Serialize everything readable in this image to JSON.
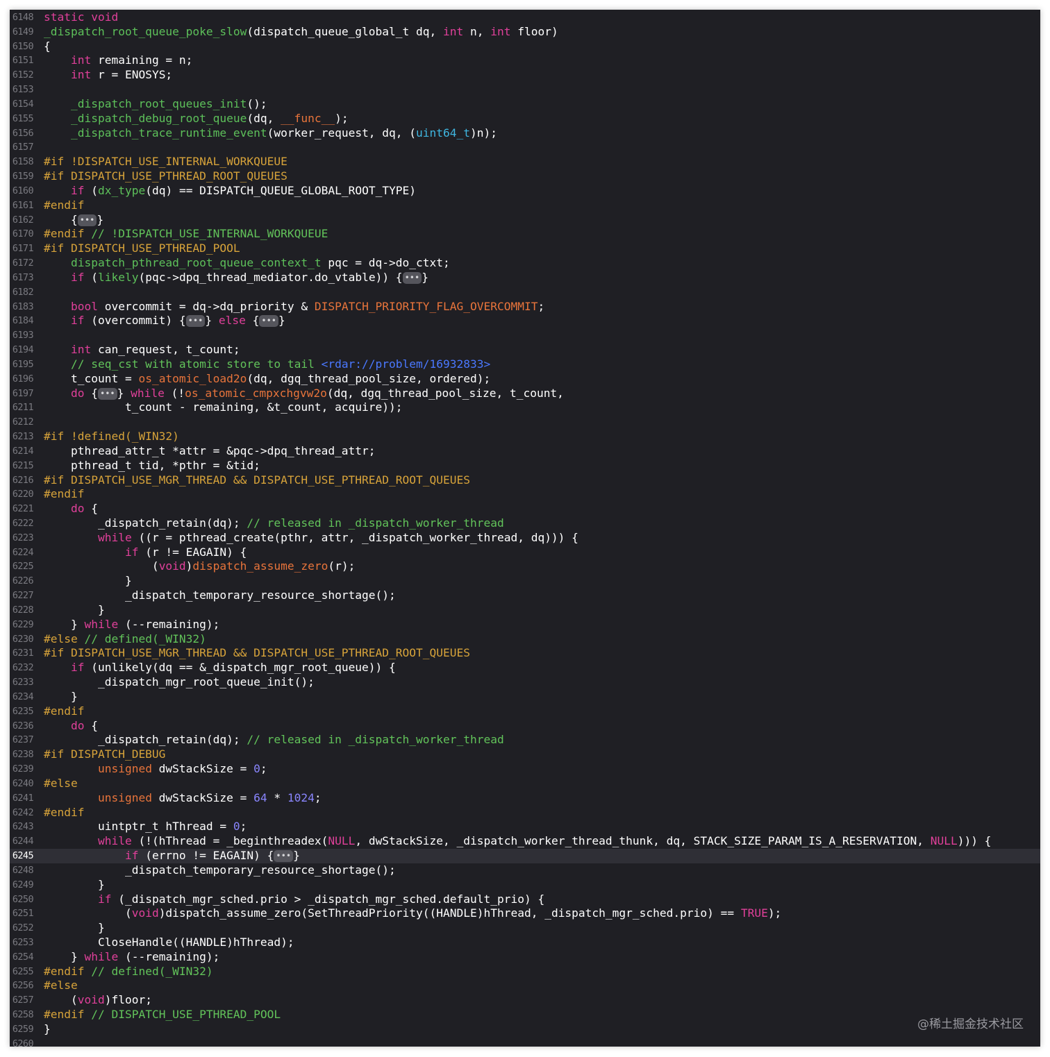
{
  "theme": {
    "background": "#1f1f24",
    "current_line_background": "#2f2f36",
    "colors": {
      "plain": "#ffffff",
      "keyword": "#fc5fa3",
      "function": "#67b7a4",
      "type": "#5dd8ff",
      "number": "#d0bf69",
      "string": "#fc6a5d",
      "comment": "#6c7986",
      "preprocessor": "#fd8f3f",
      "link": "#5482ff",
      "macro": "#fd8f3f",
      "fold": "#d5d5d8"
    }
  },
  "editor": {
    "current_line": "6245",
    "fold_placeholder": "•••",
    "watermark": "@稀土掘金技术社区"
  },
  "lines": [
    {
      "n": "6148",
      "t": [
        [
          "k",
          "static void"
        ]
      ]
    },
    {
      "n": "6149",
      "t": [
        [
          "f",
          "_dispatch_root_queue_poke_slow"
        ],
        [
          "p",
          "(dispatch_queue_global_t dq, "
        ],
        [
          "k",
          "int"
        ],
        [
          "p",
          " n, "
        ],
        [
          "k",
          "int"
        ],
        [
          "p",
          " floor)"
        ]
      ]
    },
    {
      "n": "6150",
      "t": [
        [
          "p",
          "{"
        ]
      ]
    },
    {
      "n": "6151",
      "t": [
        [
          "p",
          "    "
        ],
        [
          "k",
          "int"
        ],
        [
          "p",
          " remaining = n;"
        ]
      ]
    },
    {
      "n": "6152",
      "t": [
        [
          "p",
          "    "
        ],
        [
          "k",
          "int"
        ],
        [
          "p",
          " r = ENOSYS;"
        ]
      ]
    },
    {
      "n": "6153",
      "t": []
    },
    {
      "n": "6154",
      "t": [
        [
          "p",
          "    "
        ],
        [
          "f",
          "_dispatch_root_queues_init"
        ],
        [
          "p",
          "();"
        ]
      ]
    },
    {
      "n": "6155",
      "t": [
        [
          "p",
          "    "
        ],
        [
          "f",
          "_dispatch_debug_root_queue"
        ],
        [
          "p",
          "(dq, "
        ],
        [
          "m",
          "__func__"
        ],
        [
          "p",
          ");"
        ]
      ]
    },
    {
      "n": "6156",
      "t": [
        [
          "p",
          "    "
        ],
        [
          "f",
          "_dispatch_trace_runtime_event"
        ],
        [
          "p",
          "(worker_request, dq, ("
        ],
        [
          "y",
          "uint64_t"
        ],
        [
          "p",
          ")n);"
        ]
      ]
    },
    {
      "n": "6157",
      "t": []
    },
    {
      "n": "6158",
      "t": [
        [
          "d",
          "#if !DISPATCH_USE_INTERNAL_WORKQUEUE"
        ]
      ]
    },
    {
      "n": "6159",
      "t": [
        [
          "d",
          "#if DISPATCH_USE_PTHREAD_ROOT_QUEUES"
        ]
      ]
    },
    {
      "n": "6160",
      "t": [
        [
          "p",
          "    "
        ],
        [
          "k",
          "if"
        ],
        [
          "p",
          " ("
        ],
        [
          "f",
          "dx_type"
        ],
        [
          "p",
          "(dq) == DISPATCH_QUEUE_GLOBAL_ROOT_TYPE)"
        ]
      ]
    },
    {
      "n": "6161",
      "t": [
        [
          "d",
          "#endif"
        ]
      ]
    },
    {
      "n": "6162",
      "t": [
        [
          "p",
          "    {"
        ],
        [
          "x",
          ""
        ],
        [
          "p",
          "}"
        ]
      ]
    },
    {
      "n": "6170",
      "t": [
        [
          "d",
          "#endif "
        ],
        [
          "c",
          "// !DISPATCH_USE_INTERNAL_WORKQUEUE"
        ]
      ]
    },
    {
      "n": "6171",
      "t": [
        [
          "d",
          "#if DISPATCH_USE_PTHREAD_POOL"
        ]
      ]
    },
    {
      "n": "6172",
      "t": [
        [
          "p",
          "    "
        ],
        [
          "f",
          "dispatch_pthread_root_queue_context_t"
        ],
        [
          "p",
          " pqc = dq->do_ctxt;"
        ]
      ]
    },
    {
      "n": "6173",
      "t": [
        [
          "p",
          "    "
        ],
        [
          "k",
          "if"
        ],
        [
          "p",
          " ("
        ],
        [
          "f",
          "likely"
        ],
        [
          "p",
          "(pqc->dpq_thread_mediator.do_vtable)) {"
        ],
        [
          "x",
          ""
        ],
        [
          "p",
          "}"
        ]
      ]
    },
    {
      "n": "6182",
      "t": []
    },
    {
      "n": "6183",
      "t": [
        [
          "p",
          "    "
        ],
        [
          "k",
          "bool"
        ],
        [
          "p",
          " overcommit = dq->dq_priority & "
        ],
        [
          "m",
          "DISPATCH_PRIORITY_FLAG_OVERCOMMIT"
        ],
        [
          "p",
          ";"
        ]
      ]
    },
    {
      "n": "6184",
      "t": [
        [
          "p",
          "    "
        ],
        [
          "k",
          "if"
        ],
        [
          "p",
          " (overcommit) {"
        ],
        [
          "x",
          ""
        ],
        [
          "p",
          "} "
        ],
        [
          "k",
          "else"
        ],
        [
          "p",
          " {"
        ],
        [
          "x",
          ""
        ],
        [
          "p",
          "}"
        ]
      ]
    },
    {
      "n": "6193",
      "t": []
    },
    {
      "n": "6194",
      "t": [
        [
          "p",
          "    "
        ],
        [
          "k",
          "int"
        ],
        [
          "p",
          " can_request, t_count;"
        ]
      ]
    },
    {
      "n": "6195",
      "t": [
        [
          "p",
          "    "
        ],
        [
          "c",
          "// seq_cst with atomic store to tail "
        ],
        [
          "l",
          "<rdar://problem/16932833>"
        ]
      ]
    },
    {
      "n": "6196",
      "t": [
        [
          "p",
          "    t_count = "
        ],
        [
          "m",
          "os_atomic_load2o"
        ],
        [
          "p",
          "(dq, dgq_thread_pool_size, ordered);"
        ]
      ]
    },
    {
      "n": "6197",
      "t": [
        [
          "p",
          "    "
        ],
        [
          "k",
          "do"
        ],
        [
          "p",
          " {"
        ],
        [
          "x",
          ""
        ],
        [
          "p",
          "} "
        ],
        [
          "k",
          "while"
        ],
        [
          "p",
          " (!"
        ],
        [
          "m",
          "os_atomic_cmpxchgvw2o"
        ],
        [
          "p",
          "(dq, dgq_thread_pool_size, t_count,"
        ]
      ]
    },
    {
      "n": "6211",
      "t": [
        [
          "p",
          "            t_count - remaining, &t_count, acquire));"
        ]
      ]
    },
    {
      "n": "6212",
      "t": []
    },
    {
      "n": "6213",
      "t": [
        [
          "d",
          "#if !defined(_WIN32)"
        ]
      ]
    },
    {
      "n": "6214",
      "t": [
        [
          "p",
          "    pthread_attr_t *attr = &pqc->dpq_thread_attr;"
        ]
      ]
    },
    {
      "n": "6215",
      "t": [
        [
          "p",
          "    pthread_t tid, *pthr = &tid;"
        ]
      ]
    },
    {
      "n": "6216",
      "t": [
        [
          "d",
          "#if DISPATCH_USE_MGR_THREAD && DISPATCH_USE_PTHREAD_ROOT_QUEUES"
        ]
      ]
    },
    {
      "n": "6220",
      "t": [
        [
          "d",
          "#endif"
        ]
      ]
    },
    {
      "n": "6221",
      "t": [
        [
          "p",
          "    "
        ],
        [
          "k",
          "do"
        ],
        [
          "p",
          " {"
        ]
      ]
    },
    {
      "n": "6222",
      "t": [
        [
          "p",
          "        _dispatch_retain(dq); "
        ],
        [
          "c",
          "// released in _dispatch_worker_thread"
        ]
      ]
    },
    {
      "n": "6223",
      "t": [
        [
          "p",
          "        "
        ],
        [
          "k",
          "while"
        ],
        [
          "p",
          " ((r = pthread_create(pthr, attr, _dispatch_worker_thread, dq))) {"
        ]
      ]
    },
    {
      "n": "6224",
      "t": [
        [
          "p",
          "            "
        ],
        [
          "k",
          "if"
        ],
        [
          "p",
          " (r != EAGAIN) {"
        ]
      ]
    },
    {
      "n": "6225",
      "t": [
        [
          "p",
          "                ("
        ],
        [
          "k",
          "void"
        ],
        [
          "p",
          ")"
        ],
        [
          "m",
          "dispatch_assume_zero"
        ],
        [
          "p",
          "(r);"
        ]
      ]
    },
    {
      "n": "6226",
      "t": [
        [
          "p",
          "            }"
        ]
      ]
    },
    {
      "n": "6227",
      "t": [
        [
          "p",
          "            _dispatch_temporary_resource_shortage();"
        ]
      ]
    },
    {
      "n": "6228",
      "t": [
        [
          "p",
          "        }"
        ]
      ]
    },
    {
      "n": "6229",
      "t": [
        [
          "p",
          "    } "
        ],
        [
          "k",
          "while"
        ],
        [
          "p",
          " (--remaining);"
        ]
      ]
    },
    {
      "n": "6230",
      "t": [
        [
          "d",
          "#else "
        ],
        [
          "c",
          "// defined(_WIN32)"
        ]
      ]
    },
    {
      "n": "6231",
      "t": [
        [
          "d",
          "#if DISPATCH_USE_MGR_THREAD && DISPATCH_USE_PTHREAD_ROOT_QUEUES"
        ]
      ]
    },
    {
      "n": "6232",
      "t": [
        [
          "p",
          "    "
        ],
        [
          "k",
          "if"
        ],
        [
          "p",
          " (unlikely(dq == &_dispatch_mgr_root_queue)) {"
        ]
      ]
    },
    {
      "n": "6233",
      "t": [
        [
          "p",
          "        _dispatch_mgr_root_queue_init();"
        ]
      ]
    },
    {
      "n": "6234",
      "t": [
        [
          "p",
          "    }"
        ]
      ]
    },
    {
      "n": "6235",
      "t": [
        [
          "d",
          "#endif"
        ]
      ]
    },
    {
      "n": "6236",
      "t": [
        [
          "p",
          "    "
        ],
        [
          "k",
          "do"
        ],
        [
          "p",
          " {"
        ]
      ]
    },
    {
      "n": "6237",
      "t": [
        [
          "p",
          "        _dispatch_retain(dq); "
        ],
        [
          "c",
          "// released in _dispatch_worker_thread"
        ]
      ]
    },
    {
      "n": "6238",
      "t": [
        [
          "d",
          "#if DISPATCH_DEBUG"
        ]
      ]
    },
    {
      "n": "6239",
      "t": [
        [
          "p",
          "        "
        ],
        [
          "m",
          "unsigned"
        ],
        [
          "p",
          " dwStackSize = "
        ],
        [
          "n",
          "0"
        ],
        [
          "p",
          ";"
        ]
      ]
    },
    {
      "n": "6240",
      "t": [
        [
          "d",
          "#else"
        ]
      ]
    },
    {
      "n": "6241",
      "t": [
        [
          "p",
          "        "
        ],
        [
          "m",
          "unsigned"
        ],
        [
          "p",
          " dwStackSize = "
        ],
        [
          "n",
          "64"
        ],
        [
          "p",
          " * "
        ],
        [
          "n",
          "1024"
        ],
        [
          "p",
          ";"
        ]
      ]
    },
    {
      "n": "6242",
      "t": [
        [
          "d",
          "#endif"
        ]
      ]
    },
    {
      "n": "6243",
      "t": [
        [
          "p",
          "        uintptr_t hThread = "
        ],
        [
          "n",
          "0"
        ],
        [
          "p",
          ";"
        ]
      ]
    },
    {
      "n": "6244",
      "t": [
        [
          "p",
          "        "
        ],
        [
          "k",
          "while"
        ],
        [
          "p",
          " (!(hThread = _beginthreadex("
        ],
        [
          "k",
          "NULL"
        ],
        [
          "p",
          ", dwStackSize, _dispatch_worker_thread_thunk, dq, STACK_SIZE_PARAM_IS_A_RESERVATION, "
        ],
        [
          "k",
          "NULL"
        ],
        [
          "p",
          "))) {"
        ]
      ]
    },
    {
      "n": "6245",
      "t": [
        [
          "p",
          "            "
        ],
        [
          "k",
          "if"
        ],
        [
          "p",
          " (errno != EAGAIN) {"
        ],
        [
          "x",
          ""
        ],
        [
          "p",
          "}"
        ]
      ]
    },
    {
      "n": "6248",
      "t": [
        [
          "p",
          "            _dispatch_temporary_resource_shortage();"
        ]
      ]
    },
    {
      "n": "6249",
      "t": [
        [
          "p",
          "        }"
        ]
      ]
    },
    {
      "n": "6250",
      "t": [
        [
          "p",
          "        "
        ],
        [
          "k",
          "if"
        ],
        [
          "p",
          " (_dispatch_mgr_sched.prio > _dispatch_mgr_sched.default_prio) {"
        ]
      ]
    },
    {
      "n": "6251",
      "t": [
        [
          "p",
          "            ("
        ],
        [
          "k",
          "void"
        ],
        [
          "p",
          ")dispatch_assume_zero(SetThreadPriority((HANDLE)hThread, _dispatch_mgr_sched.prio) == "
        ],
        [
          "k",
          "TRUE"
        ],
        [
          "p",
          ");"
        ]
      ]
    },
    {
      "n": "6252",
      "t": [
        [
          "p",
          "        }"
        ]
      ]
    },
    {
      "n": "6253",
      "t": [
        [
          "p",
          "        CloseHandle((HANDLE)hThread);"
        ]
      ]
    },
    {
      "n": "6254",
      "t": [
        [
          "p",
          "    } "
        ],
        [
          "k",
          "while"
        ],
        [
          "p",
          " (--remaining);"
        ]
      ]
    },
    {
      "n": "6255",
      "t": [
        [
          "d",
          "#endif "
        ],
        [
          "c",
          "// defined(_WIN32)"
        ]
      ]
    },
    {
      "n": "6256",
      "t": [
        [
          "d",
          "#else"
        ]
      ]
    },
    {
      "n": "6257",
      "t": [
        [
          "p",
          "    ("
        ],
        [
          "k",
          "void"
        ],
        [
          "p",
          ")floor;"
        ]
      ]
    },
    {
      "n": "6258",
      "t": [
        [
          "d",
          "#endif "
        ],
        [
          "c",
          "// DISPATCH_USE_PTHREAD_POOL"
        ]
      ]
    },
    {
      "n": "6259",
      "t": [
        [
          "p",
          "}"
        ]
      ]
    },
    {
      "n": "6260",
      "t": []
    }
  ]
}
